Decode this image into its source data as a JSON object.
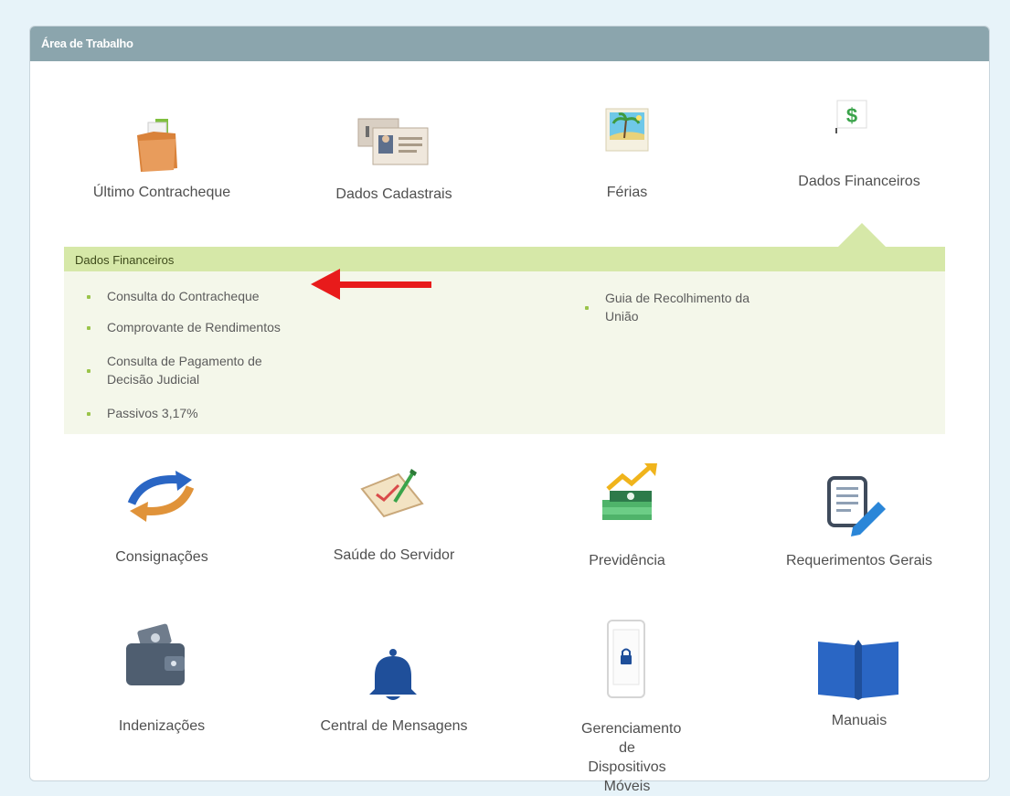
{
  "panel": {
    "title": "Área de Trabalho"
  },
  "tiles_row1": [
    {
      "label": "Último Contracheque",
      "icon": "folder-icon"
    },
    {
      "label": "Dados Cadastrais",
      "icon": "id-cards-icon"
    },
    {
      "label": "Férias",
      "icon": "vacation-photo-icon"
    },
    {
      "label": "Dados Financeiros",
      "icon": "dollar-document-icon"
    }
  ],
  "submenu": {
    "title": "Dados Financeiros",
    "left_items": [
      "Consulta do Contracheque",
      "Comprovante de Rendimentos",
      "Consulta de Pagamento de Decisão Judicial",
      "Passivos 3,17%"
    ],
    "right_items": [
      "Guia de Recolhimento da União"
    ]
  },
  "tiles_row2": [
    {
      "label": "Consignações",
      "icon": "arrows-cycle-icon"
    },
    {
      "label": "Saúde do Servidor",
      "icon": "health-checklist-icon"
    },
    {
      "label": "Previdência",
      "icon": "money-growth-icon"
    },
    {
      "label": "Requerimentos Gerais",
      "icon": "document-edit-icon"
    }
  ],
  "tiles_row3": [
    {
      "label": "Indenizações",
      "icon": "wallet-icon"
    },
    {
      "label": "Central de Mensagens",
      "icon": "bell-icon"
    },
    {
      "label": "Gerenciamento de Dispositivos Móveis",
      "icon": "locked-phone-icon"
    },
    {
      "label": "Manuais",
      "icon": "book-icon"
    }
  ],
  "colors": {
    "header": "#8ba5ad",
    "submenu_bar": "#d6e8a8",
    "annotation_arrow": "#e81b1b",
    "icon_blue": "#2a66c4"
  }
}
